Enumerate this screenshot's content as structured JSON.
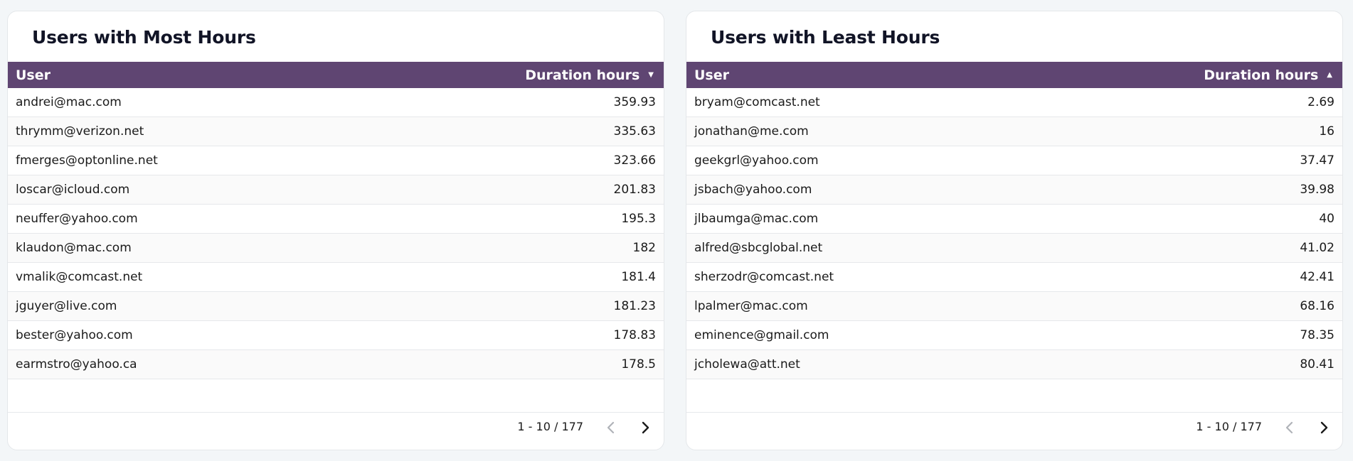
{
  "most_hours": {
    "title": "Users with Most Hours",
    "columns": {
      "user": "User",
      "duration": "Duration hours"
    },
    "sort_direction": "descending",
    "rows": [
      {
        "user": "andrei@mac.com",
        "value": "359.93"
      },
      {
        "user": "thrymm@verizon.net",
        "value": "335.63"
      },
      {
        "user": "fmerges@optonline.net",
        "value": "323.66"
      },
      {
        "user": "loscar@icloud.com",
        "value": "201.83"
      },
      {
        "user": "neuffer@yahoo.com",
        "value": "195.3"
      },
      {
        "user": "klaudon@mac.com",
        "value": "182"
      },
      {
        "user": "vmalik@comcast.net",
        "value": "181.4"
      },
      {
        "user": "jguyer@live.com",
        "value": "181.23"
      },
      {
        "user": "bester@yahoo.com",
        "value": "178.83"
      },
      {
        "user": "earmstro@yahoo.ca",
        "value": "178.5"
      }
    ],
    "pagination": "1 - 10 / 177"
  },
  "least_hours": {
    "title": "Users with Least Hours",
    "columns": {
      "user": "User",
      "duration": "Duration hours"
    },
    "sort_direction": "ascending",
    "rows": [
      {
        "user": "bryam@comcast.net",
        "value": "2.69"
      },
      {
        "user": "jonathan@me.com",
        "value": "16"
      },
      {
        "user": "geekgrl@yahoo.com",
        "value": "37.47"
      },
      {
        "user": "jsbach@yahoo.com",
        "value": "39.98"
      },
      {
        "user": "jlbaumga@mac.com",
        "value": "40"
      },
      {
        "user": "alfred@sbcglobal.net",
        "value": "41.02"
      },
      {
        "user": "sherzodr@comcast.net",
        "value": "42.41"
      },
      {
        "user": "lpalmer@mac.com",
        "value": "68.16"
      },
      {
        "user": "eminence@gmail.com",
        "value": "78.35"
      },
      {
        "user": "jcholewa@att.net",
        "value": "80.41"
      }
    ],
    "pagination": "1 - 10 / 177"
  },
  "icons": {
    "sort_desc": "sort-descending-icon",
    "sort_asc": "sort-ascending-icon",
    "prev": "chevron-left-icon",
    "next": "chevron-right-icon"
  },
  "colors": {
    "header_bg": "#5f4572",
    "page_bg": "#f3f6f8",
    "card_bg": "#ffffff"
  }
}
